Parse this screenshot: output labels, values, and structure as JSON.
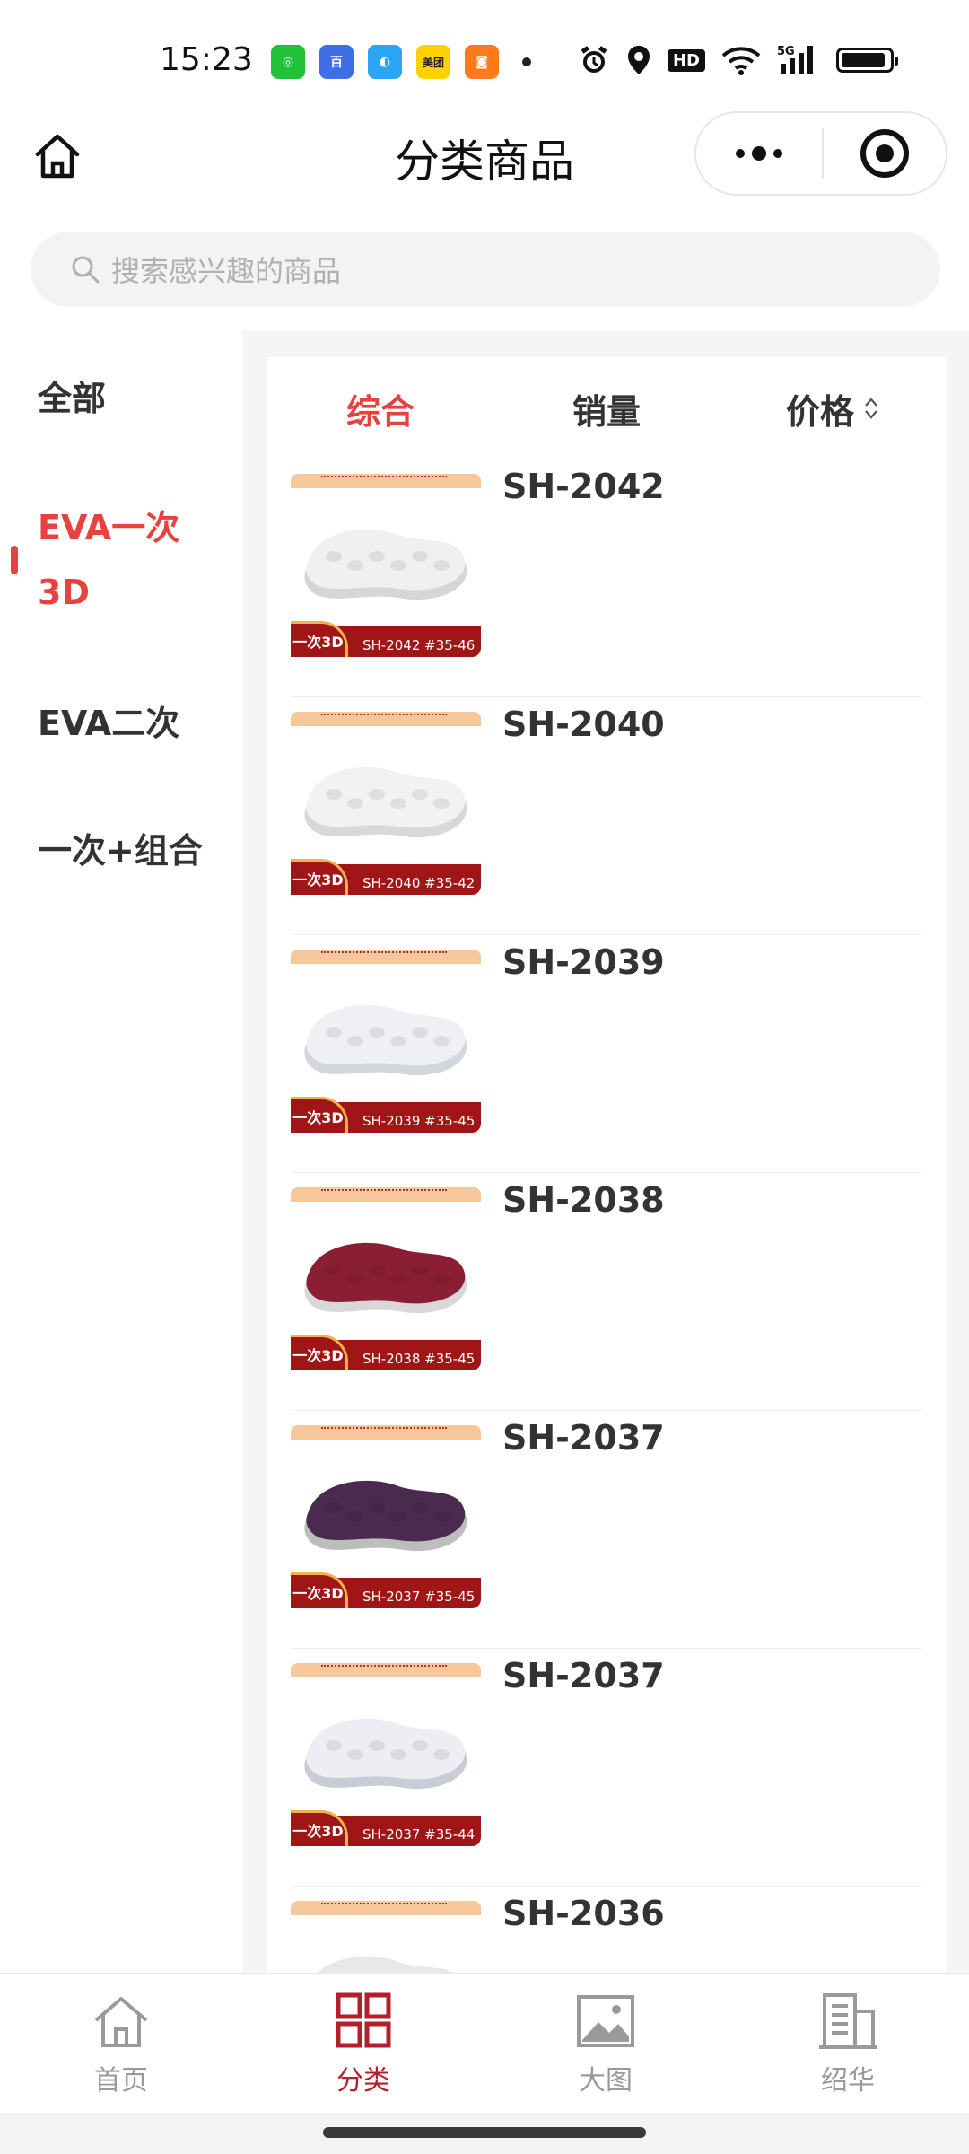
{
  "status_bar": {
    "time": "15:23",
    "app_icons": [
      {
        "name": "wechat-icon",
        "color": "#22c13a",
        "glyph": "◎"
      },
      {
        "name": "baidu-icon",
        "color": "#3f6fe8",
        "glyph": "百"
      },
      {
        "name": "browser-icon",
        "color": "#2aa6f5",
        "glyph": "◐"
      },
      {
        "name": "meituan-icon",
        "color": "#ffd100",
        "glyph": "美团"
      },
      {
        "name": "gift-app-icon",
        "color": "#ff7a1a",
        "glyph": "◙"
      }
    ],
    "hd_label": "HD",
    "network_label": "5G"
  },
  "nav": {
    "title": "分类商品"
  },
  "search": {
    "placeholder": "搜索感兴趣的商品"
  },
  "sidebar": {
    "items": [
      {
        "label": "全部",
        "active": false
      },
      {
        "label": "EVA一次3D",
        "line1": "EVA一次",
        "line2": "3D",
        "active": true
      },
      {
        "label": "EVA二次",
        "active": false
      },
      {
        "label": "一次+组合",
        "active": false
      }
    ]
  },
  "sort_tabs": [
    {
      "label": "综合",
      "active": true
    },
    {
      "label": "销量",
      "active": false
    },
    {
      "label": "价格",
      "active": false
    }
  ],
  "products": [
    {
      "name": "SH-2042",
      "thumb_label": "SH-2042 #35-46",
      "badge": "一次3D",
      "sole_color": "#f0f0f0",
      "sole_edge": "#d6d6d6"
    },
    {
      "name": "SH-2040",
      "thumb_label": "SH-2040 #35-42",
      "badge": "一次3D",
      "sole_color": "#f2f2f2",
      "sole_edge": "#d8d8d8"
    },
    {
      "name": "SH-2039",
      "thumb_label": "SH-2039 #35-45",
      "badge": "一次3D",
      "sole_color": "#eef0f4",
      "sole_edge": "#d3d6dc"
    },
    {
      "name": "SH-2038",
      "thumb_label": "SH-2038 #35-45",
      "badge": "一次3D",
      "sole_color": "#8a1f33",
      "sole_edge": "#d8d8d8"
    },
    {
      "name": "SH-2037",
      "thumb_label": "SH-2037 #35-45",
      "badge": "一次3D",
      "sole_color": "#4a2a4e",
      "sole_edge": "#bdbdbd"
    },
    {
      "name": "SH-2037",
      "thumb_label": "SH-2037 #35-44",
      "badge": "一次3D",
      "sole_color": "#eceef3",
      "sole_edge": "#c9ccd4"
    },
    {
      "name": "SH-2036",
      "thumb_label": "",
      "badge": "",
      "sole_color": "#e8e8e8",
      "sole_edge": "#d0d0d0"
    }
  ],
  "tabbar": {
    "items": [
      {
        "label": "首页",
        "active": false
      },
      {
        "label": "分类",
        "active": true
      },
      {
        "label": "大图",
        "active": false
      },
      {
        "label": "绍华",
        "active": false
      }
    ]
  },
  "colors": {
    "accent": "#e64340",
    "brand_red": "#b3202b",
    "inactive_gray": "#9a9a9a"
  }
}
